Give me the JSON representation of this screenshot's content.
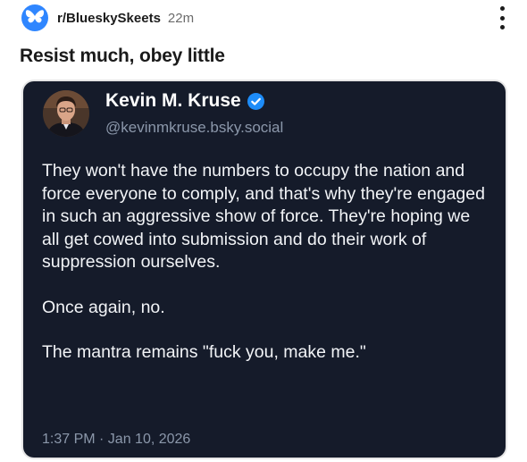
{
  "post": {
    "subreddit": "r/BlueskySkeets",
    "age": "22m",
    "title": "Resist much, obey little"
  },
  "skeet": {
    "author_name": "Kevin M. Kruse",
    "handle": "@kevinmkruse.bsky.social",
    "paragraphs": [
      "They won't have the numbers to occupy the nation and force everyone to comply, and that's why they're engaged in such an aggressive show of force. They're hoping we all get cowed into submission and do their work of suppression ourselves.",
      "Once again, no.",
      "The mantra remains \"fuck you, make me.\""
    ],
    "timestamp": "1:37 PM · Jan 10, 2026"
  },
  "icons": {
    "subreddit_icon": "butterfly-icon",
    "menu_icon": "kebab-menu-icon",
    "verified_icon": "verified-check-icon"
  },
  "colors": {
    "subreddit_icon_bg": "#2f86ff",
    "card_bg": "#151b2a",
    "verified": "#1d8cf8",
    "muted_text": "#8b97aa"
  }
}
